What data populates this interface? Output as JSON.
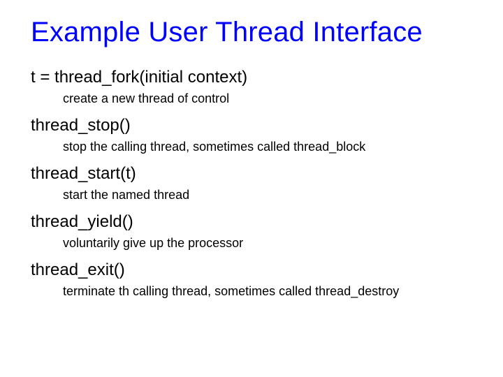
{
  "title": "Example User Thread Interface",
  "items": [
    {
      "fn": "t = thread_fork(initial context)",
      "desc": "create a new thread of control"
    },
    {
      "fn": "thread_stop()",
      "desc": "stop the calling thread, sometimes called thread_block"
    },
    {
      "fn": "thread_start(t)",
      "desc": "start the named thread"
    },
    {
      "fn": "thread_yield()",
      "desc": "voluntarily give up the processor"
    },
    {
      "fn": "thread_exit()",
      "desc": "terminate th calling thread, sometimes called thread_destroy"
    }
  ]
}
